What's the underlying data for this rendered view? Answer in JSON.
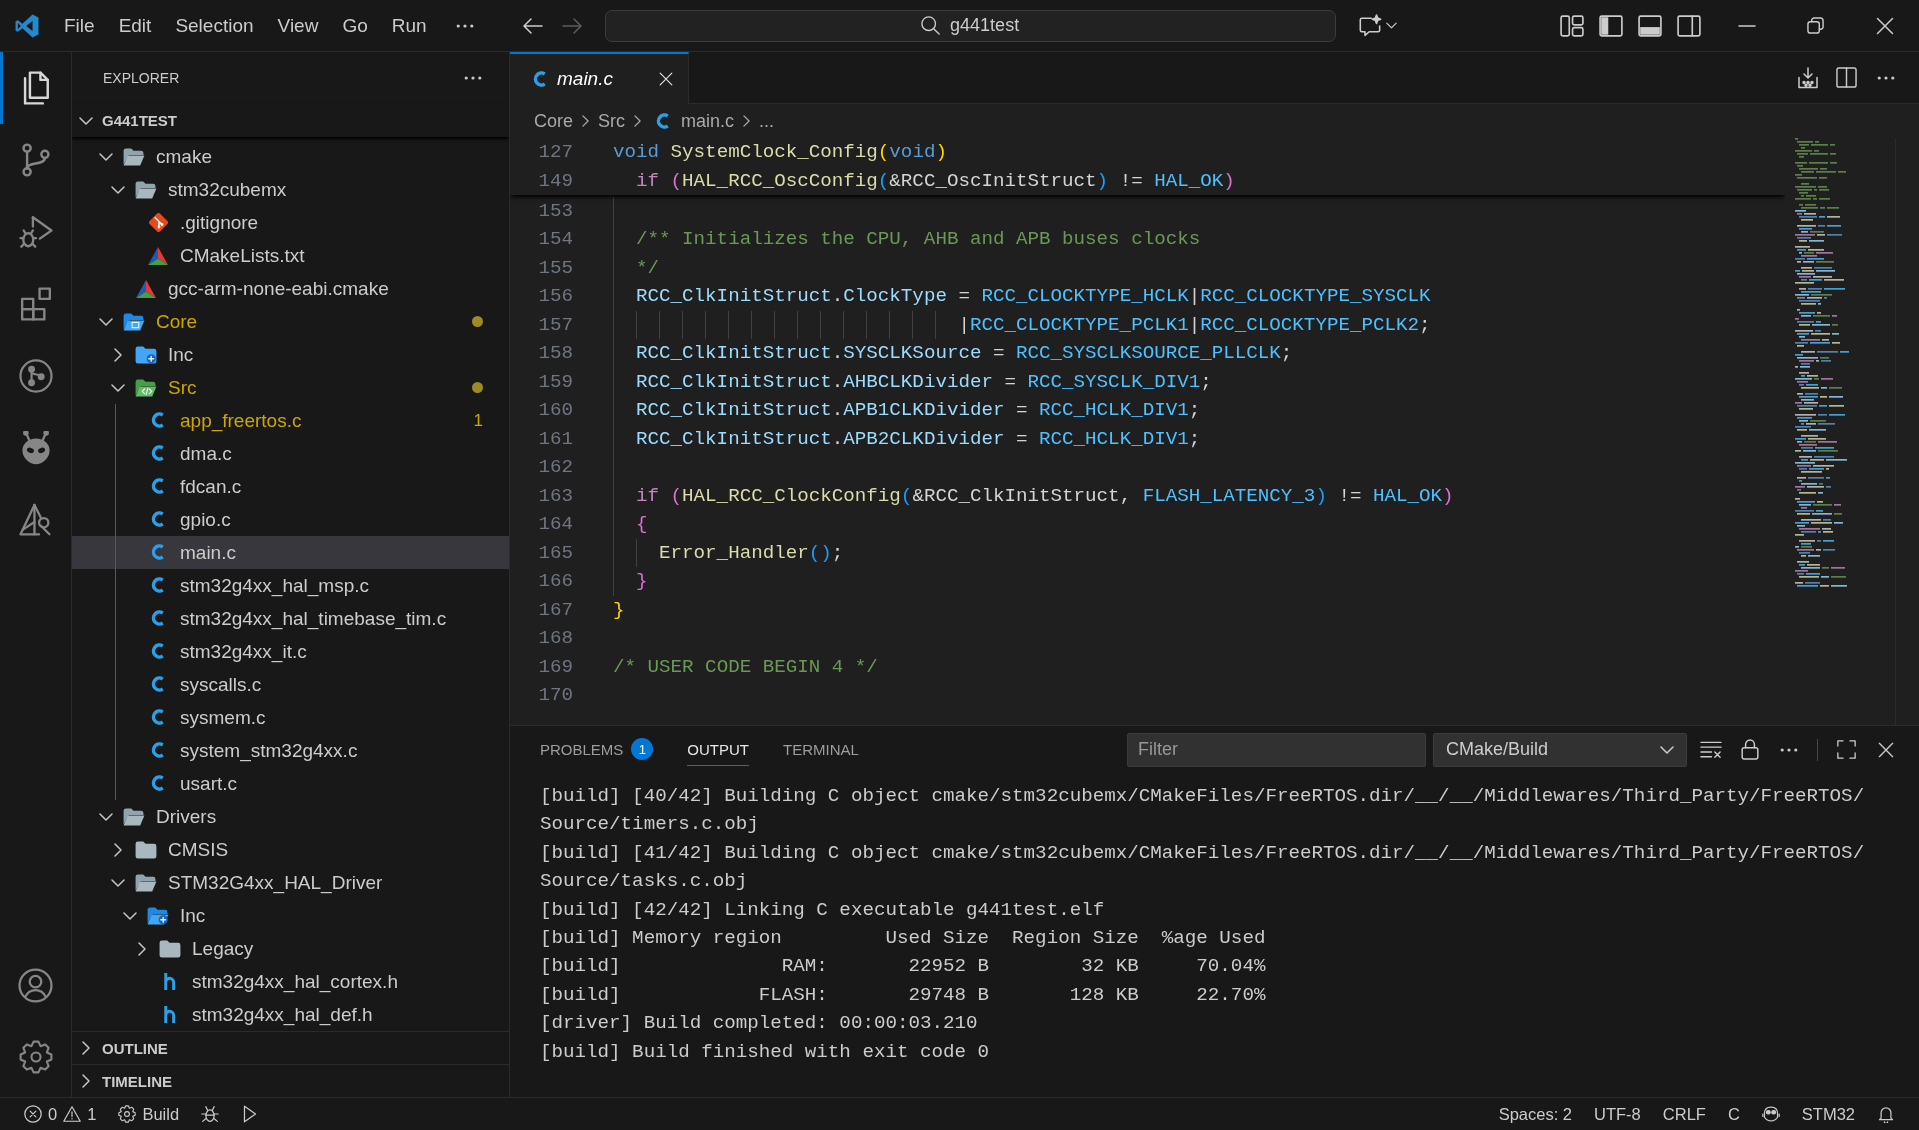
{
  "title_bar": {
    "menu": [
      "File",
      "Edit",
      "Selection",
      "View",
      "Go",
      "Run"
    ],
    "history": {
      "back": {
        "disabled": false
      },
      "forward": {
        "disabled": true
      }
    },
    "search": {
      "value": "g441test"
    }
  },
  "activity_bar": {
    "items": [
      {
        "selected": true
      },
      {
        "selected": false
      },
      {
        "selected": false
      },
      {
        "selected": false
      },
      {
        "selected": false
      },
      {
        "selected": false
      },
      {
        "selected": false
      }
    ]
  },
  "sidebar": {
    "title": "EXPLORER",
    "root": {
      "label": "G441TEST",
      "expanded": true
    },
    "tree": [
      {
        "label": "cmake",
        "kind": "folder",
        "expanded": true,
        "selected": false,
        "warning": false,
        "children": [
          {
            "label": "stm32cubemx",
            "kind": "folder",
            "expanded": true,
            "selected": false,
            "warning": false,
            "children": [
              {
                "label": ".gitignore",
                "kind": "git",
                "selected": false,
                "warning": false
              },
              {
                "label": "CMakeLists.txt",
                "kind": "cmake",
                "selected": false,
                "warning": false
              }
            ]
          },
          {
            "label": "gcc-arm-none-eabi.cmake",
            "kind": "cmake",
            "selected": false,
            "warning": false
          }
        ]
      },
      {
        "label": "Core",
        "kind": "folder-core",
        "expanded": true,
        "selected": false,
        "warning": true,
        "children": [
          {
            "label": "Inc",
            "kind": "folder-include",
            "expanded": false,
            "selected": false,
            "warning": false
          },
          {
            "label": "Src",
            "kind": "folder-source",
            "expanded": true,
            "selected": false,
            "warning": true,
            "children": [
              {
                "label": "app_freertos.c",
                "kind": "c",
                "selected": false,
                "warning": true,
                "problems": "1"
              },
              {
                "label": "dma.c",
                "kind": "c",
                "selected": false,
                "warning": false
              },
              {
                "label": "fdcan.c",
                "kind": "c",
                "selected": false,
                "warning": false
              },
              {
                "label": "gpio.c",
                "kind": "c",
                "selected": false,
                "warning": false
              },
              {
                "label": "main.c",
                "kind": "c",
                "selected": true,
                "warning": false
              },
              {
                "label": "stm32g4xx_hal_msp.c",
                "kind": "c",
                "selected": false,
                "warning": false
              },
              {
                "label": "stm32g4xx_hal_timebase_tim.c",
                "kind": "c",
                "selected": false,
                "warning": false
              },
              {
                "label": "stm32g4xx_it.c",
                "kind": "c",
                "selected": false,
                "warning": false
              },
              {
                "label": "syscalls.c",
                "kind": "c",
                "selected": false,
                "warning": false
              },
              {
                "label": "sysmem.c",
                "kind": "c",
                "selected": false,
                "warning": false
              },
              {
                "label": "system_stm32g4xx.c",
                "kind": "c",
                "selected": false,
                "warning": false
              },
              {
                "label": "usart.c",
                "kind": "c",
                "selected": false,
                "warning": false
              }
            ]
          }
        ]
      },
      {
        "label": "Drivers",
        "kind": "folder",
        "expanded": true,
        "selected": false,
        "warning": false,
        "children": [
          {
            "label": "CMSIS",
            "kind": "folder",
            "expanded": false,
            "selected": false,
            "warning": false
          },
          {
            "label": "STM32G4xx_HAL_Driver",
            "kind": "folder",
            "expanded": true,
            "selected": false,
            "warning": false,
            "children": [
              {
                "label": "Inc",
                "kind": "folder-include",
                "expanded": true,
                "selected": false,
                "warning": false,
                "children": [
                  {
                    "label": "Legacy",
                    "kind": "folder",
                    "expanded": false,
                    "selected": false,
                    "warning": false
                  },
                  {
                    "label": "stm32g4xx_hal_cortex.h",
                    "kind": "h",
                    "selected": false,
                    "warning": false
                  },
                  {
                    "label": "stm32g4xx_hal_def.h",
                    "kind": "h",
                    "selected": false,
                    "warning": false
                  }
                ]
              }
            ]
          }
        ]
      }
    ],
    "sections": [
      {
        "label": "OUTLINE",
        "expanded": false
      },
      {
        "label": "TIMELINE",
        "expanded": false
      }
    ]
  },
  "editor": {
    "tabs": [
      {
        "label": "main.c",
        "kind": "c",
        "selected": true,
        "preview": true
      }
    ],
    "breadcrumbs": [
      {
        "label": "Core",
        "kind": "folder"
      },
      {
        "label": "Src",
        "kind": "folder"
      },
      {
        "label": "main.c",
        "kind": "c"
      },
      {
        "label": "...",
        "kind": "symbol"
      }
    ],
    "sticky_lines": [
      {
        "number": "127",
        "tokens": [
          {
            "kind": "keyword",
            "text": "void "
          },
          {
            "kind": "function",
            "text": "SystemClock_Config"
          },
          {
            "kind": "bracket1",
            "text": "("
          },
          {
            "kind": "keyword",
            "text": "void"
          },
          {
            "kind": "bracket1",
            "text": ")"
          }
        ]
      },
      {
        "number": "149",
        "tokens": [
          {
            "kind": "control",
            "text": "  if "
          },
          {
            "kind": "bracket2",
            "text": "("
          },
          {
            "kind": "function",
            "text": "HAL_RCC_OscConfig"
          },
          {
            "kind": "bracket3",
            "text": "("
          },
          {
            "kind": "plain",
            "text": "&RCC_OscInitStruct"
          },
          {
            "kind": "bracket3",
            "text": ")"
          },
          {
            "kind": "plain",
            "text": " != "
          },
          {
            "kind": "macro",
            "text": "HAL_OK"
          },
          {
            "kind": "bracket2",
            "text": ")"
          }
        ]
      }
    ],
    "lines": [
      {
        "number": "153"
      },
      {
        "number": "154",
        "tokens": [
          {
            "kind": "comment",
            "text": "  /** Initializes the CPU, AHB and APB buses clocks"
          }
        ]
      },
      {
        "number": "155",
        "tokens": [
          {
            "kind": "comment",
            "text": "  */"
          }
        ]
      },
      {
        "number": "156",
        "tokens": [
          {
            "kind": "variable",
            "text": "  RCC_ClkInitStruct"
          },
          {
            "kind": "plain",
            "text": "."
          },
          {
            "kind": "variable",
            "text": "ClockType"
          },
          {
            "kind": "plain",
            "text": " = "
          },
          {
            "kind": "macro",
            "text": "RCC_CLOCKTYPE_HCLK"
          },
          {
            "kind": "plain",
            "text": "|"
          },
          {
            "kind": "macro",
            "text": "RCC_CLOCKTYPE_SYSCLK"
          }
        ]
      },
      {
        "number": "157",
        "tokens": [
          {
            "kind": "plain",
            "text": "                              |"
          },
          {
            "kind": "macro",
            "text": "RCC_CLOCKTYPE_PCLK1"
          },
          {
            "kind": "plain",
            "text": "|"
          },
          {
            "kind": "macro",
            "text": "RCC_CLOCKTYPE_PCLK2"
          },
          {
            "kind": "plain",
            "text": ";"
          }
        ]
      },
      {
        "number": "158",
        "tokens": [
          {
            "kind": "variable",
            "text": "  RCC_ClkInitStruct"
          },
          {
            "kind": "plain",
            "text": "."
          },
          {
            "kind": "variable",
            "text": "SYSCLKSource"
          },
          {
            "kind": "plain",
            "text": " = "
          },
          {
            "kind": "macro",
            "text": "RCC_SYSCLKSOURCE_PLLCLK"
          },
          {
            "kind": "plain",
            "text": ";"
          }
        ]
      },
      {
        "number": "159",
        "tokens": [
          {
            "kind": "variable",
            "text": "  RCC_ClkInitStruct"
          },
          {
            "kind": "plain",
            "text": "."
          },
          {
            "kind": "variable",
            "text": "AHBCLKDivider"
          },
          {
            "kind": "plain",
            "text": " = "
          },
          {
            "kind": "macro",
            "text": "RCC_SYSCLK_DIV1"
          },
          {
            "kind": "plain",
            "text": ";"
          }
        ]
      },
      {
        "number": "160",
        "tokens": [
          {
            "kind": "variable",
            "text": "  RCC_ClkInitStruct"
          },
          {
            "kind": "plain",
            "text": "."
          },
          {
            "kind": "variable",
            "text": "APB1CLKDivider"
          },
          {
            "kind": "plain",
            "text": " = "
          },
          {
            "kind": "macro",
            "text": "RCC_HCLK_DIV1"
          },
          {
            "kind": "plain",
            "text": ";"
          }
        ]
      },
      {
        "number": "161",
        "tokens": [
          {
            "kind": "variable",
            "text": "  RCC_ClkInitStruct"
          },
          {
            "kind": "plain",
            "text": "."
          },
          {
            "kind": "variable",
            "text": "APB2CLKDivider"
          },
          {
            "kind": "plain",
            "text": " = "
          },
          {
            "kind": "macro",
            "text": "RCC_HCLK_DIV1"
          },
          {
            "kind": "plain",
            "text": ";"
          }
        ]
      },
      {
        "number": "162"
      },
      {
        "number": "163",
        "tokens": [
          {
            "kind": "control",
            "text": "  if "
          },
          {
            "kind": "bracket2",
            "text": "("
          },
          {
            "kind": "function",
            "text": "HAL_RCC_ClockConfig"
          },
          {
            "kind": "bracket3",
            "text": "("
          },
          {
            "kind": "plain",
            "text": "&RCC_ClkInitStruct, "
          },
          {
            "kind": "macro",
            "text": "FLASH_LATENCY_3"
          },
          {
            "kind": "bracket3",
            "text": ")"
          },
          {
            "kind": "plain",
            "text": " != "
          },
          {
            "kind": "macro",
            "text": "HAL_OK"
          },
          {
            "kind": "bracket2",
            "text": ")"
          }
        ]
      },
      {
        "number": "164",
        "tokens": [
          {
            "kind": "bracket2",
            "text": "  {"
          }
        ]
      },
      {
        "number": "165",
        "tokens": [
          {
            "kind": "function",
            "text": "    Error_Handler"
          },
          {
            "kind": "bracket3",
            "text": "()"
          },
          {
            "kind": "plain",
            "text": ";"
          }
        ]
      },
      {
        "number": "166",
        "tokens": [
          {
            "kind": "bracket2",
            "text": "  }"
          }
        ]
      },
      {
        "number": "167",
        "tokens": [
          {
            "kind": "bracket1",
            "text": "}"
          }
        ]
      },
      {
        "number": "168"
      },
      {
        "number": "169",
        "tokens": [
          {
            "kind": "comment",
            "text": "/* USER CODE BEGIN 4 */"
          }
        ]
      },
      {
        "number": "170"
      }
    ]
  },
  "panel": {
    "tabs": [
      {
        "label": "PROBLEMS",
        "badge": "1",
        "selected": false
      },
      {
        "label": "OUTPUT",
        "selected": true
      },
      {
        "label": "TERMINAL",
        "selected": false
      }
    ],
    "filter": {
      "placeholder": "Filter"
    },
    "channel": {
      "value": "CMake/Build"
    },
    "output": [
      "[build] [40/42] Building C object cmake/stm32cubemx/CMakeFiles/FreeRTOS.dir/__/__/Middlewares/Third_Party/FreeRTOS/",
      "Source/timers.c.obj",
      "[build] [41/42] Building C object cmake/stm32cubemx/CMakeFiles/FreeRTOS.dir/__/__/Middlewares/Third_Party/FreeRTOS/",
      "Source/tasks.c.obj",
      "[build] [42/42] Linking C executable g441test.elf",
      "[build] Memory region         Used Size  Region Size  %age Used",
      "[build]              RAM:       22952 B        32 KB     70.04%",
      "[build]            FLASH:       29748 B       128 KB     22.70%",
      "[driver] Build completed: 00:00:03.210",
      "[build] Build finished with exit code 0"
    ]
  },
  "status_bar": {
    "left": [
      {
        "kind": "errors",
        "text": "0"
      },
      {
        "kind": "warnings",
        "text": "1"
      },
      {
        "kind": "build",
        "text": "Build"
      },
      {
        "kind": "debug"
      },
      {
        "kind": "run"
      }
    ],
    "right": [
      {
        "kind": "text",
        "text": "Spaces: 2"
      },
      {
        "kind": "text",
        "text": "UTF-8"
      },
      {
        "kind": "text",
        "text": "CRLF"
      },
      {
        "kind": "text",
        "text": "C"
      },
      {
        "kind": "assistant"
      },
      {
        "kind": "text",
        "text": "STM32"
      },
      {
        "kind": "notifications"
      }
    ]
  }
}
